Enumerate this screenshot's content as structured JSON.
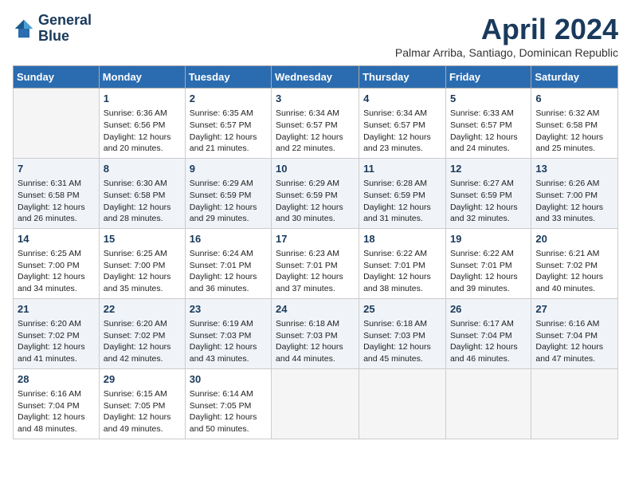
{
  "header": {
    "logo_line1": "General",
    "logo_line2": "Blue",
    "month_title": "April 2024",
    "subtitle": "Palmar Arriba, Santiago, Dominican Republic"
  },
  "days_of_week": [
    "Sunday",
    "Monday",
    "Tuesday",
    "Wednesday",
    "Thursday",
    "Friday",
    "Saturday"
  ],
  "weeks": [
    [
      {
        "day": "",
        "sunrise": "",
        "sunset": "",
        "daylight": ""
      },
      {
        "day": "1",
        "sunrise": "6:36 AM",
        "sunset": "6:56 PM",
        "daylight": "12 hours and 20 minutes."
      },
      {
        "day": "2",
        "sunrise": "6:35 AM",
        "sunset": "6:57 PM",
        "daylight": "12 hours and 21 minutes."
      },
      {
        "day": "3",
        "sunrise": "6:34 AM",
        "sunset": "6:57 PM",
        "daylight": "12 hours and 22 minutes."
      },
      {
        "day": "4",
        "sunrise": "6:34 AM",
        "sunset": "6:57 PM",
        "daylight": "12 hours and 23 minutes."
      },
      {
        "day": "5",
        "sunrise": "6:33 AM",
        "sunset": "6:57 PM",
        "daylight": "12 hours and 24 minutes."
      },
      {
        "day": "6",
        "sunrise": "6:32 AM",
        "sunset": "6:58 PM",
        "daylight": "12 hours and 25 minutes."
      }
    ],
    [
      {
        "day": "7",
        "sunrise": "6:31 AM",
        "sunset": "6:58 PM",
        "daylight": "12 hours and 26 minutes."
      },
      {
        "day": "8",
        "sunrise": "6:30 AM",
        "sunset": "6:58 PM",
        "daylight": "12 hours and 28 minutes."
      },
      {
        "day": "9",
        "sunrise": "6:29 AM",
        "sunset": "6:59 PM",
        "daylight": "12 hours and 29 minutes."
      },
      {
        "day": "10",
        "sunrise": "6:29 AM",
        "sunset": "6:59 PM",
        "daylight": "12 hours and 30 minutes."
      },
      {
        "day": "11",
        "sunrise": "6:28 AM",
        "sunset": "6:59 PM",
        "daylight": "12 hours and 31 minutes."
      },
      {
        "day": "12",
        "sunrise": "6:27 AM",
        "sunset": "6:59 PM",
        "daylight": "12 hours and 32 minutes."
      },
      {
        "day": "13",
        "sunrise": "6:26 AM",
        "sunset": "7:00 PM",
        "daylight": "12 hours and 33 minutes."
      }
    ],
    [
      {
        "day": "14",
        "sunrise": "6:25 AM",
        "sunset": "7:00 PM",
        "daylight": "12 hours and 34 minutes."
      },
      {
        "day": "15",
        "sunrise": "6:25 AM",
        "sunset": "7:00 PM",
        "daylight": "12 hours and 35 minutes."
      },
      {
        "day": "16",
        "sunrise": "6:24 AM",
        "sunset": "7:01 PM",
        "daylight": "12 hours and 36 minutes."
      },
      {
        "day": "17",
        "sunrise": "6:23 AM",
        "sunset": "7:01 PM",
        "daylight": "12 hours and 37 minutes."
      },
      {
        "day": "18",
        "sunrise": "6:22 AM",
        "sunset": "7:01 PM",
        "daylight": "12 hours and 38 minutes."
      },
      {
        "day": "19",
        "sunrise": "6:22 AM",
        "sunset": "7:01 PM",
        "daylight": "12 hours and 39 minutes."
      },
      {
        "day": "20",
        "sunrise": "6:21 AM",
        "sunset": "7:02 PM",
        "daylight": "12 hours and 40 minutes."
      }
    ],
    [
      {
        "day": "21",
        "sunrise": "6:20 AM",
        "sunset": "7:02 PM",
        "daylight": "12 hours and 41 minutes."
      },
      {
        "day": "22",
        "sunrise": "6:20 AM",
        "sunset": "7:02 PM",
        "daylight": "12 hours and 42 minutes."
      },
      {
        "day": "23",
        "sunrise": "6:19 AM",
        "sunset": "7:03 PM",
        "daylight": "12 hours and 43 minutes."
      },
      {
        "day": "24",
        "sunrise": "6:18 AM",
        "sunset": "7:03 PM",
        "daylight": "12 hours and 44 minutes."
      },
      {
        "day": "25",
        "sunrise": "6:18 AM",
        "sunset": "7:03 PM",
        "daylight": "12 hours and 45 minutes."
      },
      {
        "day": "26",
        "sunrise": "6:17 AM",
        "sunset": "7:04 PM",
        "daylight": "12 hours and 46 minutes."
      },
      {
        "day": "27",
        "sunrise": "6:16 AM",
        "sunset": "7:04 PM",
        "daylight": "12 hours and 47 minutes."
      }
    ],
    [
      {
        "day": "28",
        "sunrise": "6:16 AM",
        "sunset": "7:04 PM",
        "daylight": "12 hours and 48 minutes."
      },
      {
        "day": "29",
        "sunrise": "6:15 AM",
        "sunset": "7:05 PM",
        "daylight": "12 hours and 49 minutes."
      },
      {
        "day": "30",
        "sunrise": "6:14 AM",
        "sunset": "7:05 PM",
        "daylight": "12 hours and 50 minutes."
      },
      {
        "day": "",
        "sunrise": "",
        "sunset": "",
        "daylight": ""
      },
      {
        "day": "",
        "sunrise": "",
        "sunset": "",
        "daylight": ""
      },
      {
        "day": "",
        "sunrise": "",
        "sunset": "",
        "daylight": ""
      },
      {
        "day": "",
        "sunrise": "",
        "sunset": "",
        "daylight": ""
      }
    ]
  ],
  "labels": {
    "sunrise_prefix": "Sunrise: ",
    "sunset_prefix": "Sunset: ",
    "daylight_prefix": "Daylight: "
  }
}
